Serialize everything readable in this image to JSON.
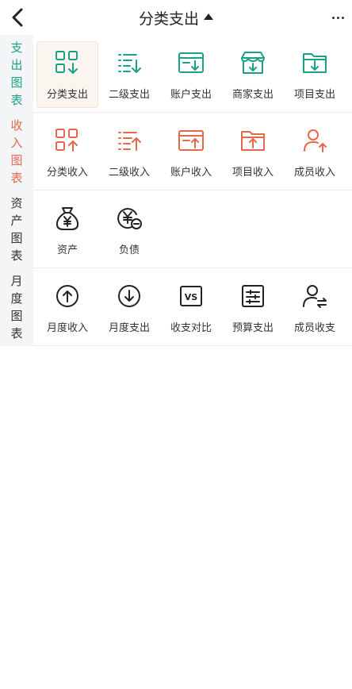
{
  "header": {
    "title": "分类支出",
    "back_icon": "chevron-left-icon",
    "more_icon": "more-dots-icon"
  },
  "colors": {
    "expense": "#1aa288",
    "income": "#e5674c",
    "neutral": "#333333",
    "sidebar_bg": "#f4f5f7",
    "selected_bg": "#fbf5ef"
  },
  "sections": [
    {
      "side": [
        "支",
        "出",
        "图",
        "表"
      ],
      "items": [
        {
          "label": "分类支出",
          "icon": "category-grid-down-icon"
        },
        {
          "label": "二级支出",
          "icon": "list-down-icon"
        },
        {
          "label": "账户支出",
          "icon": "account-card-down-icon"
        },
        {
          "label": "商家支出",
          "icon": "shop-down-icon"
        },
        {
          "label": "项目支出",
          "icon": "folder-down-icon"
        }
      ]
    },
    {
      "side": [
        "收",
        "入",
        "图",
        "表"
      ],
      "items": [
        {
          "label": "分类收入",
          "icon": "category-grid-up-icon"
        },
        {
          "label": "二级收入",
          "icon": "list-up-icon"
        },
        {
          "label": "账户收入",
          "icon": "account-card-up-icon"
        },
        {
          "label": "项目收入",
          "icon": "folder-up-icon"
        },
        {
          "label": "成员收入",
          "icon": "member-up-icon"
        }
      ]
    },
    {
      "side": [
        "资",
        "产",
        "图",
        "表"
      ],
      "items": [
        {
          "label": "资产",
          "icon": "money-bag-icon"
        },
        {
          "label": "负债",
          "icon": "debt-coin-icon"
        }
      ]
    },
    {
      "side": [
        "月",
        "度",
        "图",
        "表"
      ],
      "items": [
        {
          "label": "月度收入",
          "icon": "circle-arrow-up-icon"
        },
        {
          "label": "月度支出",
          "icon": "circle-arrow-down-icon"
        },
        {
          "label": "收支对比",
          "icon": "vs-icon",
          "icon_text": "VS"
        },
        {
          "label": "预算支出",
          "icon": "budget-sliders-icon"
        },
        {
          "label": "成员收支",
          "icon": "member-exchange-icon"
        }
      ]
    }
  ]
}
